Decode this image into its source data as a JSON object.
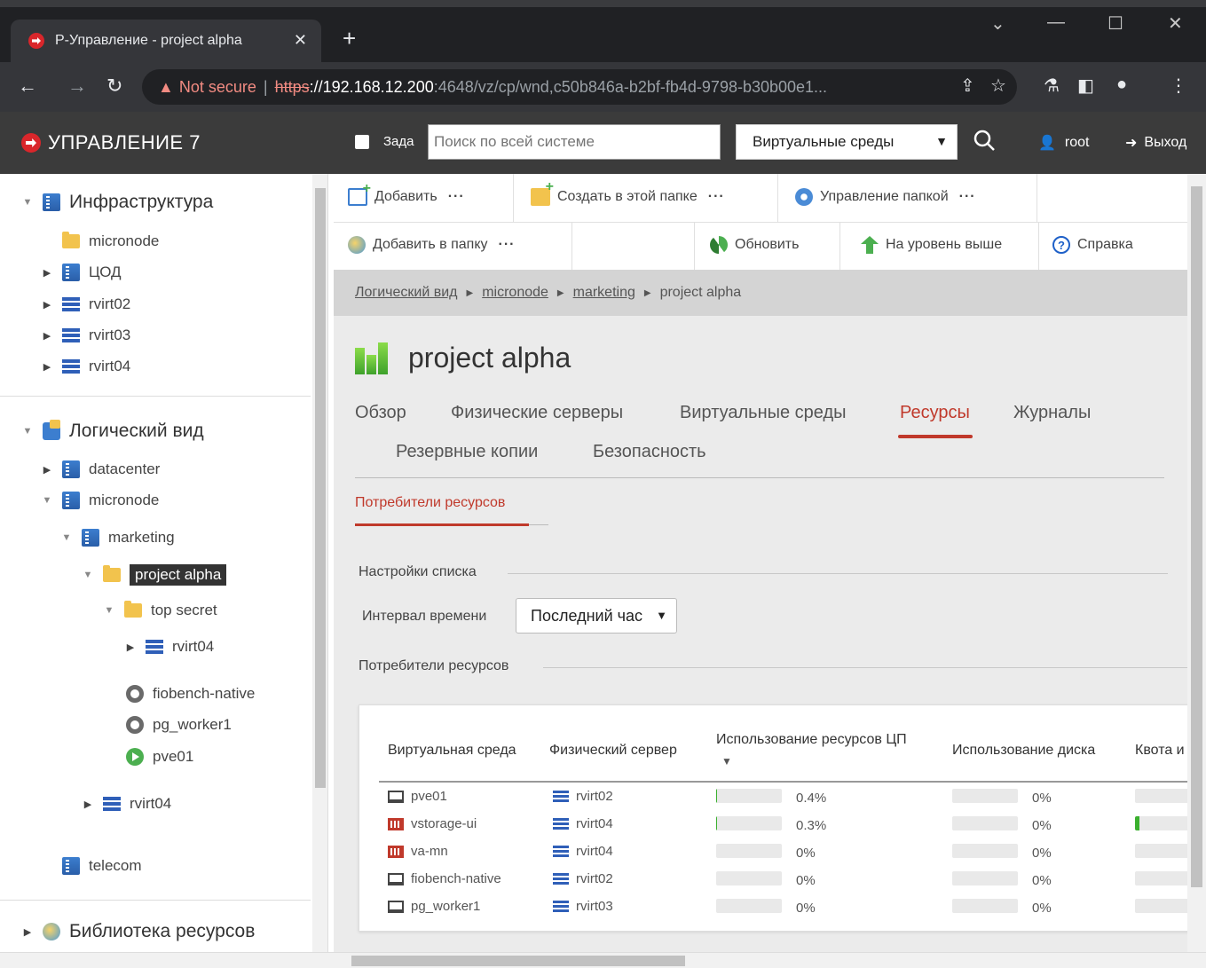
{
  "browser": {
    "tab_title": "Р-Управление - project alpha",
    "tab_close": "✕",
    "new_tab": "+",
    "url_warning": "Not secure",
    "url_scheme": "https",
    "url_host": "://192.168.12.200",
    "url_rest": ":4648/vz/cp/wnd,c50b846a-b2bf-fb4d-9798-b30b00e1...",
    "window_controls": [
      "⌄",
      "—",
      "☐",
      "✕"
    ]
  },
  "app": {
    "logo_text": "УПРАВЛЕНИЕ 7",
    "tasks_label": "Зада",
    "search_placeholder": "Поиск по всей системе",
    "search_scope": "Виртуальные среды",
    "user": "root",
    "logout": "Выход"
  },
  "sidebar": {
    "infra_title": "Инфраструктура",
    "infra_items": [
      "micronode",
      "ЦОД",
      "rvirt02",
      "rvirt03",
      "rvirt04"
    ],
    "logical_title": "Логический вид",
    "logical_items": {
      "datacenter": "datacenter",
      "micronode": "micronode",
      "marketing": "marketing",
      "project_alpha": "project alpha",
      "top_secret": "top secret",
      "rvirt04_child": "rvirt04",
      "fiobench": "fiobench-native",
      "pg_worker": "pg_worker1",
      "pve01": "pve01",
      "rvirt04": "rvirt04",
      "telecom": "telecom"
    },
    "library_title": "Библиотека ресурсов"
  },
  "toolbar": {
    "add": "Добавить",
    "create_in_folder": "Создать в этой папке",
    "manage_folder": "Управление папкой",
    "add_to_folder": "Добавить в папку",
    "refresh": "Обновить",
    "level_up": "На уровень выше",
    "help": "Справка",
    "more": "···"
  },
  "breadcrumb": [
    "Логический вид",
    "micronode",
    "marketing",
    "project alpha"
  ],
  "page": {
    "title": "project alpha",
    "tabs": [
      "Обзор",
      "Физические серверы",
      "Виртуальные среды",
      "Ресурсы",
      "Журналы",
      "Резервные копии",
      "Безопасность"
    ],
    "active_tab": "Ресурсы",
    "subtab": "Потребители ресурсов",
    "list_settings": "Настройки списка",
    "interval_label": "Интервал времени",
    "interval_value": "Последний час",
    "consumers_title": "Потребители ресурсов"
  },
  "table": {
    "headers": {
      "vm": "Виртуальная среда",
      "server": "Физический сервер",
      "cpu": "Использование ресурсов ЦП",
      "cpu_sort": "▼",
      "disk": "Использование диска",
      "quota": "Квота и"
    },
    "rows": [
      {
        "vm": "pve01",
        "type": "vm",
        "server": "rvirt02",
        "cpu": "0.4%",
        "cpu_frac": 0.004,
        "disk": "0%",
        "quota_frac": 0
      },
      {
        "vm": "vstorage-ui",
        "type": "ct",
        "server": "rvirt04",
        "cpu": "0.3%",
        "cpu_frac": 0.003,
        "disk": "0%",
        "quota_frac": 0.08
      },
      {
        "vm": "va-mn",
        "type": "ct",
        "server": "rvirt04",
        "cpu": "0%",
        "cpu_frac": 0,
        "disk": "0%",
        "quota_frac": 0
      },
      {
        "vm": "fiobench-native",
        "type": "vm",
        "server": "rvirt02",
        "cpu": "0%",
        "cpu_frac": 0,
        "disk": "0%",
        "quota_frac": 0
      },
      {
        "vm": "pg_worker1",
        "type": "vm",
        "server": "rvirt03",
        "cpu": "0%",
        "cpu_frac": 0,
        "disk": "0%",
        "quota_frac": 0
      }
    ]
  },
  "colors": {
    "accent": "#c0392b",
    "brand": "#d9262b",
    "header_bg": "#3b3b3b",
    "bar_fill": "#3ab02e"
  }
}
